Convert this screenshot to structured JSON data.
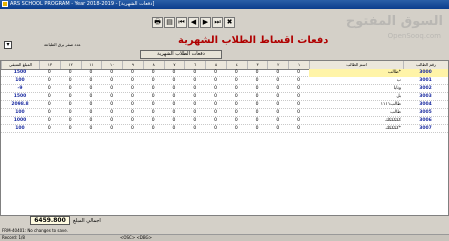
{
  "window": {
    "title": "ARS SCHOOL PROGRAM - Year 2018-2019 - [دفعات الشهرية]"
  },
  "watermark": {
    "arabic": "السوق المفتوح",
    "english": "OpenSooq.com"
  },
  "toolbar": {
    "buttons": [
      {
        "name": "print-button",
        "glyph": "🖶"
      },
      {
        "name": "preview-button",
        "glyph": "▤"
      },
      {
        "name": "first-record-button",
        "glyph": "⏮"
      },
      {
        "name": "prev-record-button",
        "glyph": "◀"
      },
      {
        "name": "next-record-button",
        "glyph": "▶"
      },
      {
        "name": "last-record-button",
        "glyph": "⏭"
      },
      {
        "name": "close-button",
        "glyph": "✖"
      }
    ]
  },
  "mode": {
    "label": "عدد صفر برق الطباعة",
    "checked": false
  },
  "heading": "دفعات اقساط الطلاب الشهرية",
  "section_title": "دفعات الطلاب الشهرية",
  "columns": {
    "student_no": "رقم الطالب",
    "student_name": "اسم الطالب",
    "months": [
      "١",
      "٢",
      "٣",
      "٤",
      "٥",
      "٦",
      "٧",
      "٨",
      "٩",
      "١٠",
      "١١",
      "١٢",
      "١٣"
    ],
    "remaining": "المبلغ المتبقي"
  },
  "rows": [
    {
      "id": "3000",
      "name": "طالب*",
      "months": [
        "0",
        "0",
        "0",
        "0",
        "0",
        "0",
        "0",
        "0",
        "0",
        "0",
        "0",
        "0",
        "0"
      ],
      "remaining": "1500",
      "selected": true
    },
    {
      "id": "3001",
      "name": "ب",
      "months": [
        "0",
        "0",
        "0",
        "0",
        "0",
        "0",
        "0",
        "0",
        "0",
        "0",
        "0",
        "0",
        "0"
      ],
      "remaining": "100"
    },
    {
      "id": "3002",
      "name": "ونايا",
      "months": [
        "0",
        "0",
        "0",
        "0",
        "0",
        "0",
        "0",
        "0",
        "0",
        "0",
        "0",
        "0",
        "0"
      ],
      "remaining": "-9"
    },
    {
      "id": "3003",
      "name": "بل",
      "months": [
        "0",
        "0",
        "0",
        "0",
        "0",
        "0",
        "0",
        "0",
        "0",
        "0",
        "0",
        "0",
        "0"
      ],
      "remaining": "1500"
    },
    {
      "id": "3004",
      "name": "طالب١١١١",
      "months": [
        "0",
        "0",
        "0",
        "0",
        "0",
        "0",
        "0",
        "0",
        "0",
        "0",
        "0",
        "0",
        "0"
      ],
      "remaining": "2098.8"
    },
    {
      "id": "3005",
      "name": "طالب",
      "months": [
        "0",
        "0",
        "0",
        "0",
        "0",
        "0",
        "0",
        "0",
        "0",
        "0",
        "0",
        "0",
        "0"
      ],
      "remaining": "100"
    },
    {
      "id": "3006",
      "name": "كككككك",
      "months": [
        "0",
        "0",
        "0",
        "0",
        "0",
        "0",
        "0",
        "0",
        "0",
        "0",
        "0",
        "0",
        "0"
      ],
      "remaining": "1000"
    },
    {
      "id": "3007",
      "name": "ككككك*",
      "months": [
        "0",
        "0",
        "0",
        "0",
        "0",
        "0",
        "0",
        "0",
        "0",
        "0",
        "0",
        "0",
        "0"
      ],
      "remaining": "100"
    }
  ],
  "total": {
    "label": "اجمالي المبلغ",
    "value": "6459.800"
  },
  "status": {
    "line1": "Record: 1/8",
    "line2": "FRM-40401: No changes to save.",
    "line3": "<OSC> <DBG>"
  }
}
